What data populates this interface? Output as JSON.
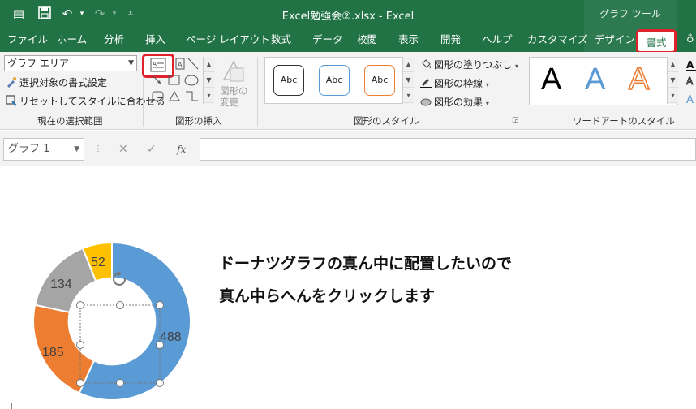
{
  "window": {
    "title": "Excel勉強会②.xlsx  -  Excel",
    "context_tab_group": "グラフ ツール"
  },
  "tabs": [
    "ファイル",
    "ホーム",
    "分析",
    "挿入",
    "ページ レイアウト",
    "数式",
    "データ",
    "校閲",
    "表示",
    "開発",
    "ヘルプ",
    "カスタマイズ",
    "デザイン",
    "書式"
  ],
  "active_tab": "書式",
  "ribbon": {
    "selection": {
      "dropdown_value": "グラフ エリア",
      "format_selection": "選択対象の書式設定",
      "reset_style": "リセットしてスタイルに合わせる",
      "group_label": "現在の選択範囲"
    },
    "insert_shapes": {
      "change_shape": "図形の\n変更",
      "group_label": "図形の挿入"
    },
    "shape_styles": {
      "samples": [
        "Abc",
        "Abc",
        "Abc"
      ],
      "fill": "図形の塗りつぶし",
      "outline": "図形の枠線",
      "effects": "図形の効果",
      "group_label": "図形のスタイル"
    },
    "wordart": {
      "letters": [
        "A",
        "A",
        "A"
      ],
      "group_label": "ワードアートのスタイル"
    }
  },
  "formula_bar": {
    "name_box": "グラフ 1",
    "fx": "fx"
  },
  "chart_data": {
    "type": "pie",
    "hole": 0.55,
    "categories": [
      "",
      "",
      "",
      ""
    ],
    "values": [
      488,
      185,
      134,
      52
    ],
    "labels": [
      "488",
      "185",
      "134",
      "52"
    ],
    "colors": [
      "#5b9bd5",
      "#ed7d31",
      "#a5a5a5",
      "#ffc000"
    ]
  },
  "sheet_text": {
    "line1": "ドーナツグラフの真ん中に配置したいので",
    "line2": "真ん中らへんをクリックします"
  },
  "colors": {
    "excel_green": "#217346",
    "highlight_red": "#e0202a"
  }
}
